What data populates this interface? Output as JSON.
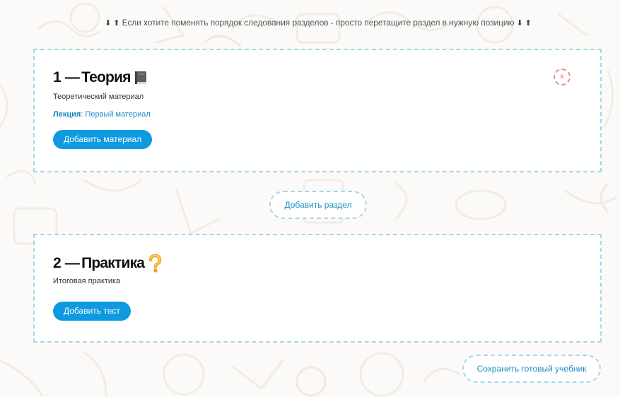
{
  "hint": {
    "arrows_left": "⬇ ⬆",
    "text": "Если хотите поменять порядок следования разделов - просто перетащите раздел в нужную позицию",
    "arrows_right": "⬇ ⬆"
  },
  "sections": [
    {
      "number": "1",
      "dash": "—",
      "title": "Теория",
      "icon": "book-icon",
      "description": "Теоретический материал",
      "material_type": "Лекция",
      "material_sep": ":",
      "material_name": "Первый материал",
      "add_button": "Добавить материал",
      "remove_label": "x"
    },
    {
      "number": "2",
      "dash": "—",
      "title": "Практика",
      "icon": "question-mark-icon",
      "description": "Итоговая практика",
      "add_button": "Добавить тест"
    }
  ],
  "add_section_button": "Добавить раздел",
  "save_button": "Сохранить готовый учебник",
  "colors": {
    "accent": "#0e9ae0",
    "dashed_border": "#a6d6ea",
    "remove": "#e6937e",
    "link": "#1a8fc9"
  }
}
